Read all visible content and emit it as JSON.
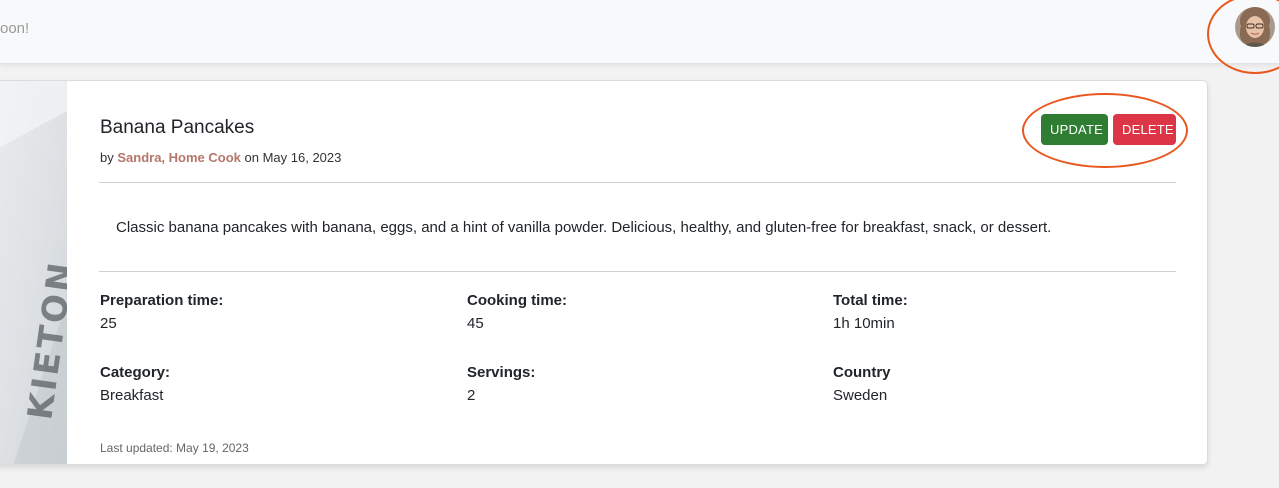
{
  "header": {
    "text": "oon!",
    "avatar": "user-avatar"
  },
  "recipe": {
    "title": "Banana Pancakes",
    "by_prefix": "by",
    "author": "Sandra, Home Cook",
    "on_text": "on May 16, 2023",
    "update_label": "UPDATE",
    "delete_label": "DELETE",
    "description": "Classic banana pancakes with banana, eggs, and a hint of vanilla powder. Delicious, healthy, and gluten-free for breakfast, snack, or dessert.",
    "fields": [
      {
        "label": "Preparation time:",
        "value": "25"
      },
      {
        "label": "Cooking time:",
        "value": "45"
      },
      {
        "label": "Total time:",
        "value": "1h 10min"
      },
      {
        "label": "Category:",
        "value": "Breakfast"
      },
      {
        "label": "Servings:",
        "value": "2"
      },
      {
        "label": "Country",
        "value": "Sweden"
      }
    ],
    "last_updated": "Last updated: May 19, 2023"
  },
  "colors": {
    "update": "#2e7d32",
    "delete": "#dc3545",
    "author": "#b4776a",
    "highlight_ring": "#e8571e"
  }
}
